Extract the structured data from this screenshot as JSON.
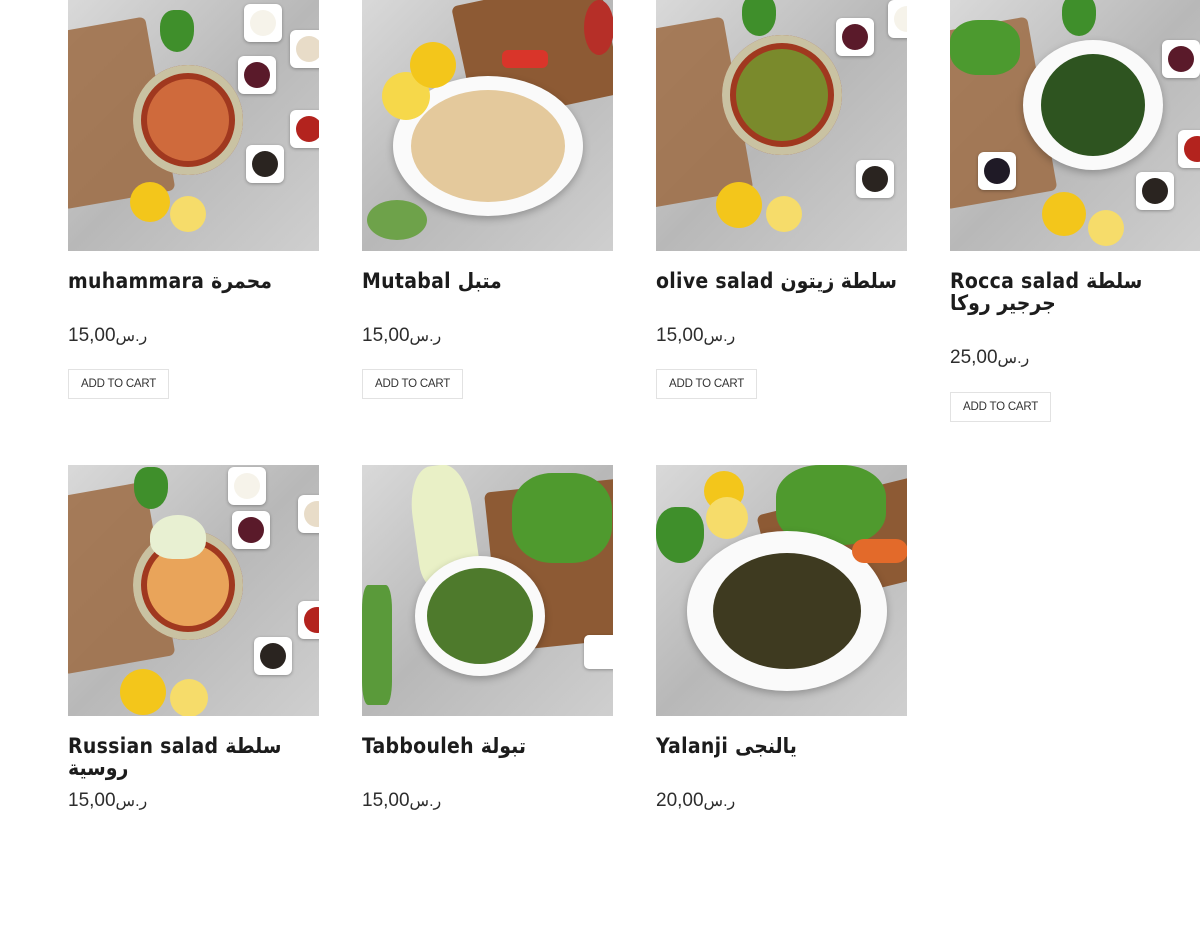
{
  "products": [
    {
      "title": "muhammara محمرة",
      "currency": "ر.س",
      "price": "15,00",
      "cart_label": "ADD TO CART"
    },
    {
      "title": "Mutabal متبل",
      "currency": "ر.س",
      "price": "15,00",
      "cart_label": "ADD TO CART"
    },
    {
      "title": "olive salad سلطة زيتون",
      "currency": "ر.س",
      "price": "15,00",
      "cart_label": "ADD TO CART"
    },
    {
      "title": "Rocca salad سلطة جرجير روكا",
      "currency": "ر.س",
      "price": "25,00",
      "cart_label": "ADD TO CART"
    },
    {
      "title": "Russian salad سلطة روسية",
      "currency": "ر.س",
      "price": "15,00"
    },
    {
      "title": "Tabbouleh تبولة",
      "currency": "ر.س",
      "price": "15,00"
    },
    {
      "title": "Yalanji يالنجى",
      "currency": "ر.س",
      "price": "20,00"
    }
  ]
}
